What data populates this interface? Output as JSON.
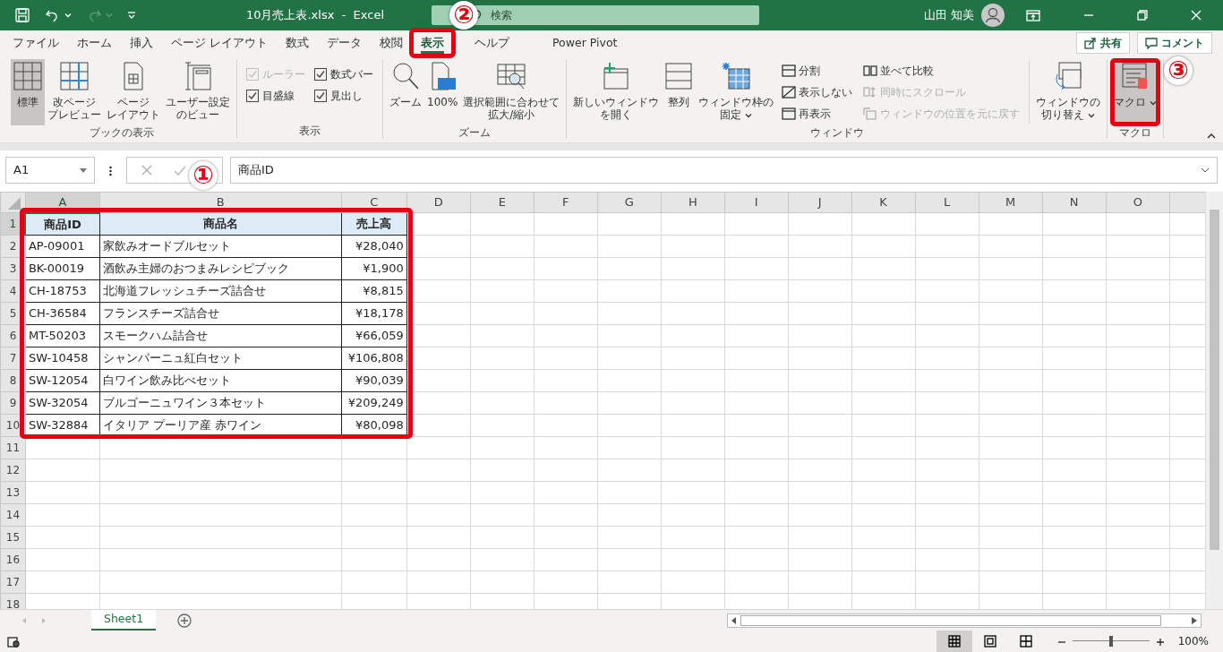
{
  "title_bar": {
    "title": "10月売上表.xlsx  -  Excel",
    "search": {
      "placeholder": "検索"
    },
    "user": "山田 知美",
    "redo_disabled": true
  },
  "tabs": [
    {
      "label": "ファイル",
      "selected": false,
      "highlighted": false
    },
    {
      "label": "ホーム",
      "selected": false,
      "highlighted": false
    },
    {
      "label": "挿入",
      "selected": false,
      "highlighted": false
    },
    {
      "label": "ページ レイアウト",
      "selected": false,
      "highlighted": false
    },
    {
      "label": "数式",
      "selected": false,
      "highlighted": false
    },
    {
      "label": "データ",
      "selected": false,
      "highlighted": false
    },
    {
      "label": "校閲",
      "selected": false,
      "highlighted": false
    },
    {
      "label": "表示",
      "selected": true,
      "highlighted": true
    },
    {
      "label": "ヘルプ",
      "selected": false,
      "highlighted": false
    },
    {
      "label": "Power Pivot",
      "selected": false,
      "highlighted": false
    }
  ],
  "tab_actions": [
    {
      "label": "共有"
    },
    {
      "label": "コメント"
    }
  ],
  "ribbon": [
    {
      "name": "ブックの表示",
      "items": [
        {
          "kind": "large",
          "label": "標準",
          "selected": true,
          "highlighted": false
        },
        {
          "kind": "large",
          "label": "改ページプレビュー",
          "selected": false,
          "highlighted": false
        },
        {
          "kind": "large",
          "label": "ページレイアウト",
          "selected": false,
          "highlighted": false
        },
        {
          "kind": "large",
          "label": "ユーザー設定のビュー",
          "selected": false,
          "highlighted": false
        }
      ]
    },
    {
      "name": "表示",
      "items": [
        {
          "kind": "check",
          "label": "ルーラー",
          "checked": true,
          "disabled": true
        },
        {
          "kind": "check",
          "label": "数式バー",
          "checked": true,
          "disabled": false
        },
        {
          "kind": "check",
          "label": "目盛線",
          "checked": true,
          "disabled": false
        },
        {
          "kind": "check",
          "label": "見出し",
          "checked": true,
          "disabled": false
        }
      ]
    },
    {
      "name": "ズーム",
      "items": [
        {
          "kind": "large",
          "label": "ズーム",
          "selected": false,
          "highlighted": false
        },
        {
          "kind": "large",
          "label": "100%",
          "selected": false,
          "highlighted": false
        },
        {
          "kind": "large",
          "label": "選択範囲に合わせて拡大/縮小",
          "selected": false,
          "highlighted": false
        }
      ]
    },
    {
      "name": "ウィンドウ",
      "items": [
        {
          "kind": "large",
          "label": "新しいウィンドウを開く",
          "selected": false,
          "highlighted": false
        },
        {
          "kind": "large",
          "label": "整列",
          "selected": false,
          "highlighted": false
        },
        {
          "kind": "large",
          "label": "ウィンドウ枠の固定",
          "dropdown": true,
          "selected": false,
          "highlighted": false
        },
        {
          "kind": "stack",
          "items": [
            {
              "label": "分割",
              "disabled": false
            },
            {
              "label": "表示しない",
              "disabled": false
            },
            {
              "label": "再表示",
              "disabled": false
            }
          ]
        },
        {
          "kind": "stack",
          "items": [
            {
              "label": "並べて比較",
              "disabled": false
            },
            {
              "label": "同時にスクロール",
              "disabled": true
            },
            {
              "label": "ウィンドウの位置を元に戻す",
              "disabled": true
            }
          ]
        },
        {
          "kind": "large",
          "label": "ウィンドウの切り替え",
          "dropdown": true,
          "selected": false,
          "highlighted": false
        }
      ]
    },
    {
      "name": "マクロ",
      "items": [
        {
          "kind": "large",
          "label": "マクロ",
          "dropdown": true,
          "selected": true,
          "highlighted": true
        }
      ]
    }
  ],
  "formula_bar": {
    "name_box": "A1",
    "formula": "商品ID",
    "enter_disabled": true
  },
  "sheet": {
    "highlighted": true,
    "columns": [
      {
        "label": "A",
        "selected": true
      },
      {
        "label": "B",
        "selected": false
      },
      {
        "label": "C",
        "selected": false
      },
      {
        "label": "D",
        "selected": false
      },
      {
        "label": "E",
        "selected": false
      },
      {
        "label": "F",
        "selected": false
      },
      {
        "label": "G",
        "selected": false
      },
      {
        "label": "H",
        "selected": false
      },
      {
        "label": "I",
        "selected": false
      },
      {
        "label": "J",
        "selected": false
      },
      {
        "label": "K",
        "selected": false
      },
      {
        "label": "L",
        "selected": false
      },
      {
        "label": "M",
        "selected": false
      },
      {
        "label": "N",
        "selected": false
      },
      {
        "label": "O",
        "selected": false
      }
    ],
    "rows": [
      {
        "header": "1",
        "selected": true,
        "kind": "header",
        "cells": [
          "商品ID",
          "商品名",
          "売上高"
        ]
      },
      {
        "header": "2",
        "selected": false,
        "kind": "data",
        "cells": [
          "AP-09001",
          "家飲みオードブルセット",
          "¥28,040"
        ]
      },
      {
        "header": "3",
        "selected": false,
        "kind": "data",
        "cells": [
          "BK-00019",
          "酒飲み主婦のおつまみレシピブック",
          "¥1,900"
        ]
      },
      {
        "header": "4",
        "selected": false,
        "kind": "data",
        "cells": [
          "CH-18753",
          "北海道フレッシュチーズ詰合せ",
          "¥8,815"
        ]
      },
      {
        "header": "5",
        "selected": false,
        "kind": "data",
        "cells": [
          "CH-36584",
          "フランスチーズ詰合せ",
          "¥18,178"
        ]
      },
      {
        "header": "6",
        "selected": false,
        "kind": "data",
        "cells": [
          "MT-50203",
          "スモークハム詰合せ",
          "¥66,059"
        ]
      },
      {
        "header": "7",
        "selected": false,
        "kind": "data",
        "cells": [
          "SW-10458",
          "シャンパーニュ紅白セット",
          "¥106,808"
        ]
      },
      {
        "header": "8",
        "selected": false,
        "kind": "data",
        "cells": [
          "SW-12054",
          "白ワイン飲み比べセット",
          "¥90,039"
        ]
      },
      {
        "header": "9",
        "selected": false,
        "kind": "data",
        "cells": [
          "SW-32054",
          "ブルゴーニュワイン３本セット",
          "¥209,249"
        ]
      },
      {
        "header": "10",
        "selected": false,
        "kind": "data",
        "cells": [
          "SW-32884",
          "イタリア プーリア産 赤ワイン",
          "¥80,098"
        ]
      },
      {
        "header": "11",
        "selected": false,
        "kind": "empty"
      },
      {
        "header": "12",
        "selected": false,
        "kind": "empty"
      },
      {
        "header": "13",
        "selected": false,
        "kind": "empty"
      },
      {
        "header": "14",
        "selected": false,
        "kind": "empty"
      },
      {
        "header": "15",
        "selected": false,
        "kind": "empty"
      },
      {
        "header": "16",
        "selected": false,
        "kind": "empty"
      },
      {
        "header": "17",
        "selected": false,
        "kind": "empty"
      },
      {
        "header": "18",
        "selected": false,
        "kind": "empty"
      }
    ]
  },
  "sheet_tabs": [
    {
      "label": "Sheet1",
      "selected": true
    }
  ],
  "status_bar": {
    "views": [
      {
        "selected": true
      },
      {
        "selected": false
      },
      {
        "selected": false
      }
    ],
    "zoom": {
      "level": 0.5
    },
    "zoom_label": "100%"
  },
  "annotations": [
    {
      "label": "①"
    },
    {
      "label": "②"
    },
    {
      "label": "③"
    }
  ]
}
